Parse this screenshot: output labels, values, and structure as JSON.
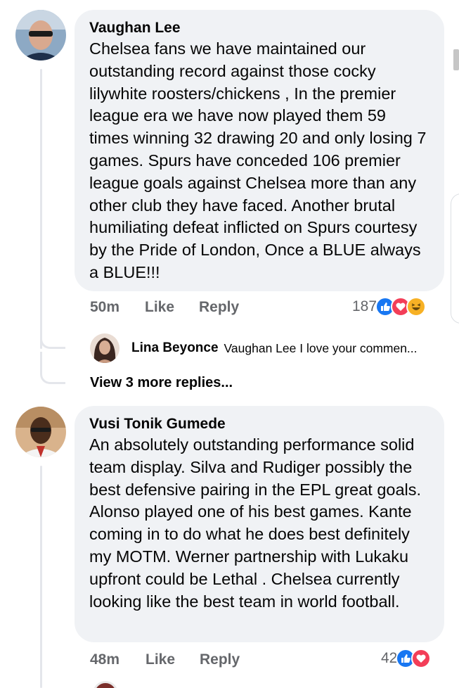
{
  "comments": [
    {
      "author": "Vaughan Lee",
      "text": "Chelsea fans we have maintained our outstanding record against those cocky lilywhite roosters/chickens , In the premier league era we have now played them 59 times winning 32 drawing 20 and only losing 7 games. Spurs have conceded 106 premier league goals against Chelsea more than any other club they have faced. Another brutal humiliating defeat inflicted on Spurs courtesy by the Pride of London, Once a BLUE always a BLUE!!!",
      "time": "50m",
      "like_label": "Like",
      "reply_label": "Reply",
      "reaction_count": "187",
      "reactions": [
        "like-icon",
        "love-icon",
        "haha-icon"
      ],
      "reply": {
        "author": "Lina Beyonce",
        "text": "Vaughan Lee I love your commen..."
      },
      "view_more": "View 3 more replies..."
    },
    {
      "author": "Vusi Tonik Gumede",
      "text": "An absolutely outstanding performance solid team display. Silva and Rudiger possibly the best defensive pairing in the EPL great goals. Alonso played one of his best games. Kante coming in to do what he does best definitely my MOTM. Werner partnership with Lukaku upfront could be Lethal . Chelsea currently looking like the best team in world football.",
      "time": "48m",
      "like_label": "Like",
      "reply_label": "Reply",
      "reaction_count": "42",
      "reactions": [
        "like-icon",
        "love-icon"
      ]
    }
  ],
  "colors": {
    "bubble": "#f0f2f5",
    "meta": "#65676b",
    "like": "#1877f2",
    "love": "#f33e58",
    "haha": "#f7b125"
  }
}
